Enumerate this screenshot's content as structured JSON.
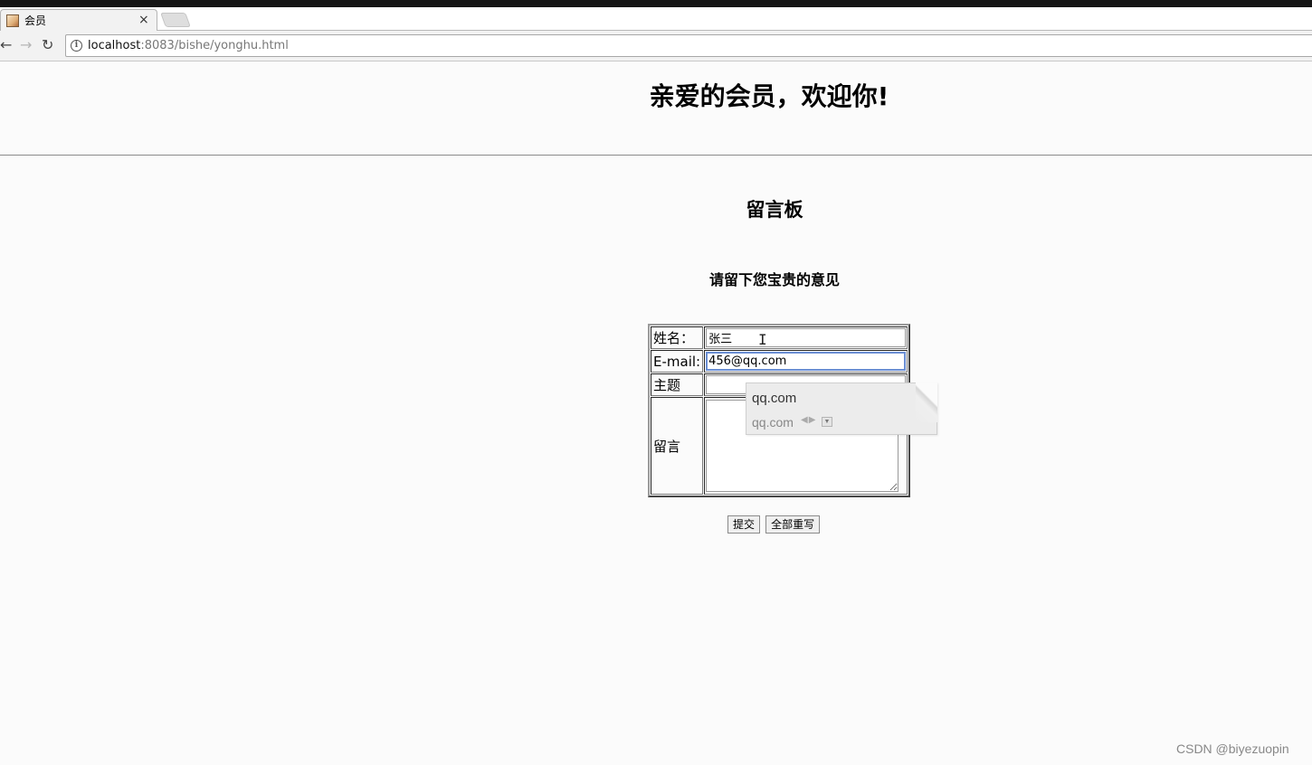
{
  "browser": {
    "tab_title": "会员",
    "tab_close": "×",
    "url_host": "localhost",
    "url_rest": ":8083/bishe/yonghu.html",
    "info_icon": "i"
  },
  "page": {
    "main_title": "亲爱的会员，欢迎你!",
    "board_title": "留言板",
    "subtitle": "请留下您宝贵的意见"
  },
  "form": {
    "name_label": "姓名：",
    "name_value": "张三",
    "email_label": "E-mail:",
    "email_value": "456@qq.com",
    "subject_label": "主题",
    "subject_value": "",
    "message_label": "留言",
    "message_value": ""
  },
  "autofill": {
    "typed": "qq.com",
    "suggestion": "qq.com"
  },
  "buttons": {
    "submit": "提交",
    "reset": "全部重写"
  },
  "watermark": "CSDN @biyezuopin",
  "icons": {
    "back": "back-arrow-icon",
    "forward": "forward-arrow-icon",
    "reload": "reload-icon",
    "info": "info-icon",
    "favicon": "favicon-icon",
    "dropdown": "dropdown-icon"
  }
}
